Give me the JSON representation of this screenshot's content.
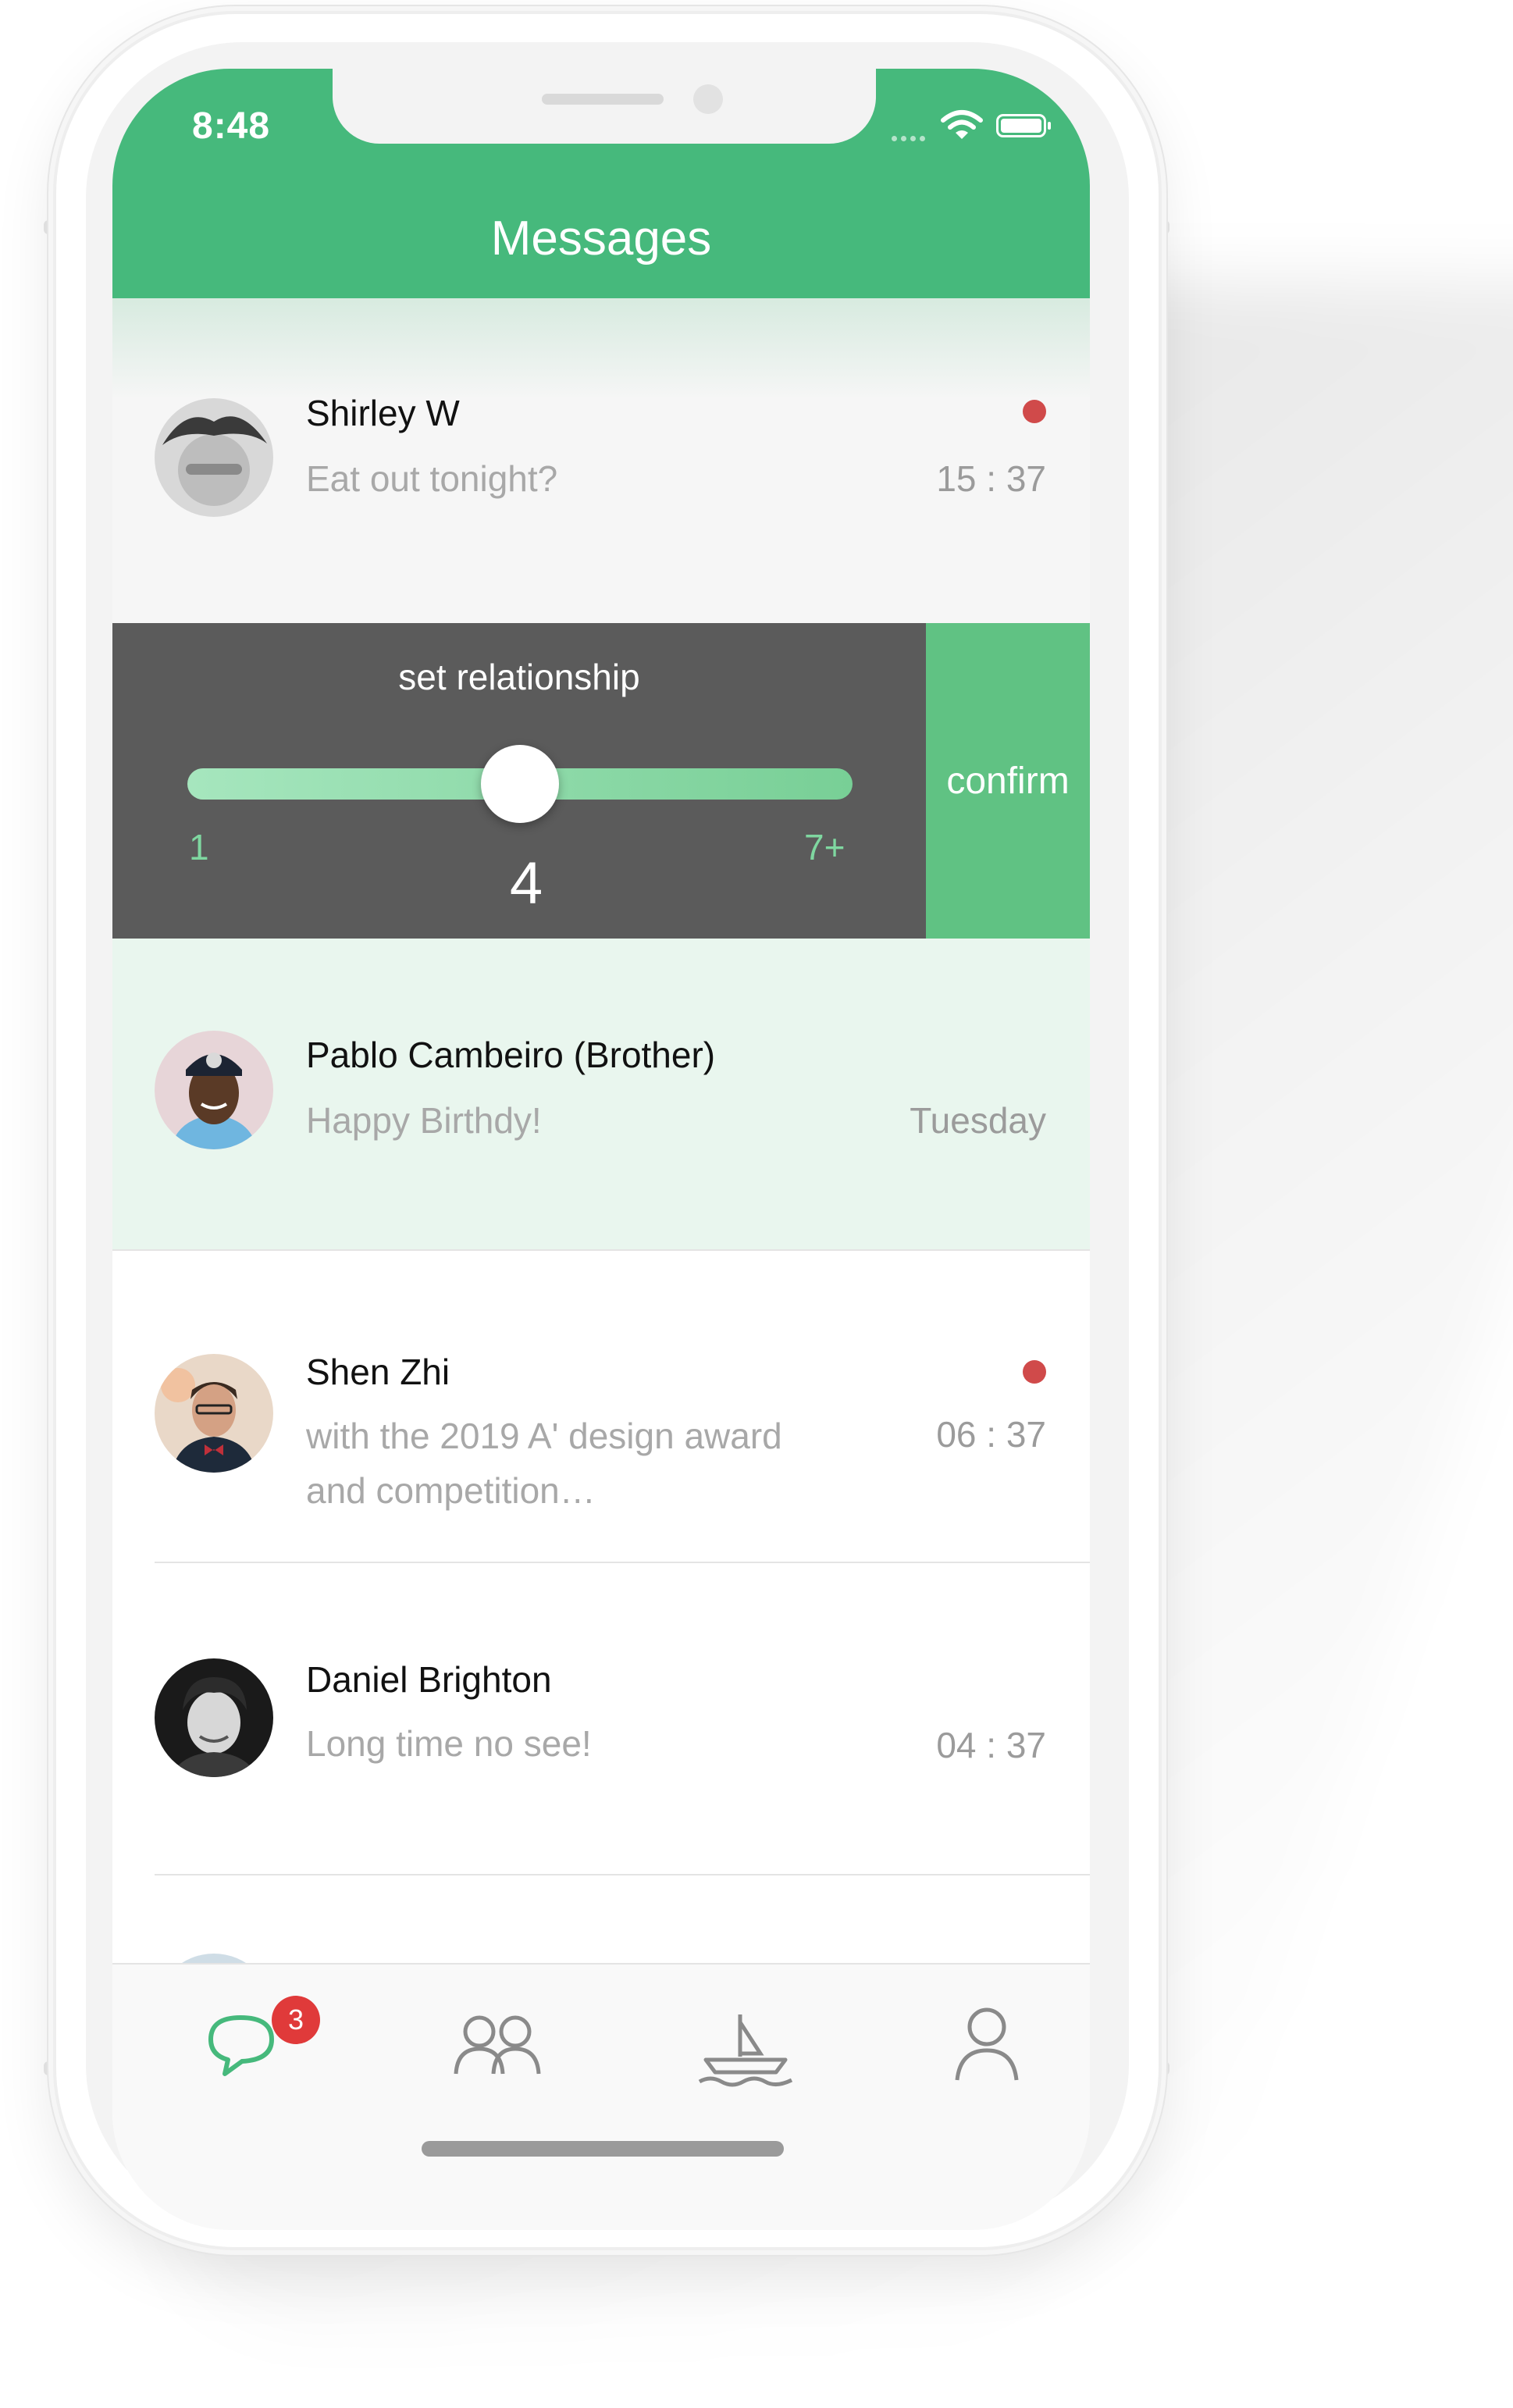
{
  "status_bar": {
    "time": "8:48"
  },
  "header": {
    "title": "Messages"
  },
  "conversations": [
    {
      "name": "Shirley W",
      "preview": "Eat out tonight?",
      "time": "15 : 37",
      "unread": true
    },
    {
      "name": "Pablo Cambeiro (Brother)",
      "preview": "Happy Birthdy!",
      "time": "Tuesday",
      "unread": false
    },
    {
      "name": "Shen Zhi",
      "preview_line1": "with the 2019 A' design award",
      "preview_line2": "and competition…",
      "time": "06 : 37",
      "unread": true
    },
    {
      "name": "Daniel Brighton",
      "preview": "Long time no see!",
      "time": "04 : 37",
      "unread": false
    }
  ],
  "relationship": {
    "title": "set relationship",
    "min_label": "1",
    "max_label": "7+",
    "value_label": "4",
    "slider_fraction": 0.5,
    "confirm_label": "confirm"
  },
  "tabbar": {
    "messages_badge": "3",
    "tabs": [
      "chat-bubble-icon",
      "friends-icon",
      "boat-icon",
      "profile-icon"
    ]
  },
  "colors": {
    "brand_green": "#46b97c",
    "confirm_green": "#60c283",
    "panel_gray": "#5b5b5b",
    "unread_red": "#d04a4a",
    "highlight_row": "#e9f6ee"
  }
}
